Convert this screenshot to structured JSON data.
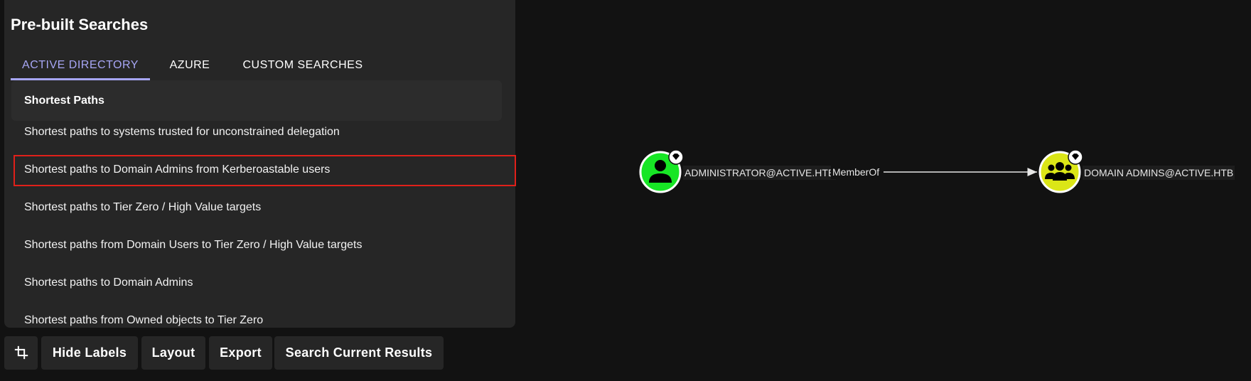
{
  "panel": {
    "title": "Pre-built Searches",
    "tabs": [
      {
        "label": "ACTIVE DIRECTORY",
        "active": true
      },
      {
        "label": "AZURE",
        "active": false
      },
      {
        "label": "CUSTOM SEARCHES",
        "active": false
      }
    ],
    "section_header": "Shortest Paths",
    "items": [
      {
        "label": "Shortest paths to systems trusted for unconstrained delegation"
      },
      {
        "label": "Shortest paths to Domain Admins from Kerberoastable users",
        "highlighted": true
      },
      {
        "label": "Shortest paths to Tier Zero / High Value targets"
      },
      {
        "label": "Shortest paths from Domain Users to Tier Zero / High Value targets"
      },
      {
        "label": "Shortest paths to Domain Admins"
      },
      {
        "label": "Shortest paths from Owned objects to Tier Zero"
      }
    ]
  },
  "toolbar": {
    "crop_icon": "crop-icon",
    "hide_labels": "Hide Labels",
    "layout": "Layout",
    "export": "Export",
    "search_current_results": "Search Current Results"
  },
  "graph": {
    "nodes": [
      {
        "label": "ADMINISTRATOR@ACTIVE.HTB",
        "type": "user",
        "icon": "user-icon",
        "badge_icon": "tier-zero-gem-icon",
        "color": "#17e625"
      },
      {
        "label": "DOMAIN ADMINS@ACTIVE.HTB",
        "type": "group",
        "icon": "group-icon",
        "badge_icon": "tier-zero-gem-icon",
        "color": "#dbe617"
      }
    ],
    "edge": {
      "label": "MemberOf"
    }
  },
  "colors": {
    "accent": "#a7a6f5",
    "highlight_border": "#e0201a",
    "background": "#121212",
    "panel": "#262626"
  }
}
